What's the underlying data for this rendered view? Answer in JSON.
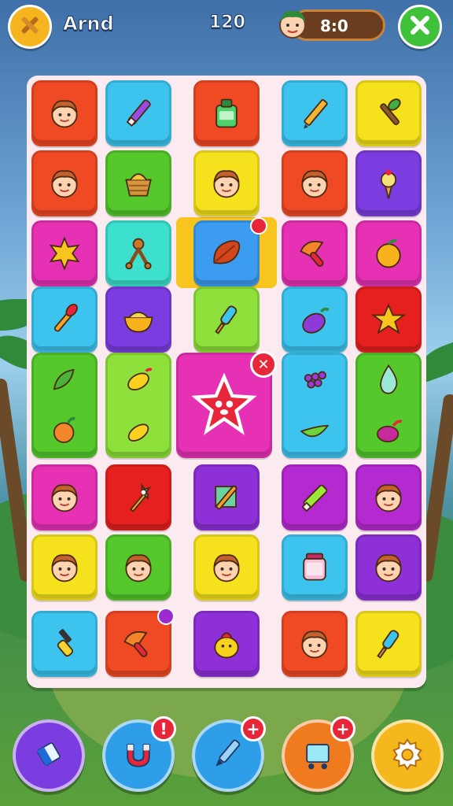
{
  "header": {
    "menu_icon": "crossed-tools-icon",
    "title": "Arnd",
    "score": "120",
    "coins": "8:0",
    "close_icon": "close-icon"
  },
  "board": {
    "rows": 8,
    "cols": 5,
    "tiles": [
      {
        "color": "#f04a24",
        "icon": "face-icon"
      },
      {
        "color": "#3cc4ee",
        "icon": "marker-icon"
      },
      {
        "color": "#f04a24",
        "icon": "glue-bottle-icon"
      },
      {
        "color": "#3cc4ee",
        "icon": "pencil-icon"
      },
      {
        "color": "#f6e21c",
        "icon": "paint-brush-icon"
      },
      {
        "color": "#f04a24",
        "icon": "face-icon"
      },
      {
        "color": "#55c82c",
        "icon": "basket-icon"
      },
      {
        "color": "#f6e21c",
        "icon": "face-icon"
      },
      {
        "color": "#f04a24",
        "icon": "face-icon"
      },
      {
        "color": "#7b3de0",
        "icon": "ice-cream-icon"
      },
      {
        "color": "#e631b5",
        "icon": "sun-star-icon"
      },
      {
        "color": "#3ce0cc",
        "icon": "gingerbread-icon"
      },
      {
        "color": "#3c9cf0",
        "icon": "leaf-icon"
      },
      {
        "color": "#e631b5",
        "icon": "mushroom-icon"
      },
      {
        "color": "#e631b5",
        "icon": "orange-icon"
      },
      {
        "color": "#3cc4ee",
        "icon": "brush-icon"
      },
      {
        "color": "#7b3de0",
        "icon": "bowl-icon"
      },
      {
        "color": "#8ee03a",
        "icon": "popsicle-icon"
      },
      {
        "color": "#3cc4ee",
        "icon": "eggplant-icon"
      },
      {
        "color": "#e6201e",
        "icon": "star-icon"
      },
      {
        "color": "#55c82c",
        "icon": "pepper-icon"
      },
      {
        "color": "#8ee03a",
        "icon": "lemon-icon"
      },
      {
        "color": "#e631b5",
        "icon": "starfish-icon"
      },
      {
        "color": "#3cc4ee",
        "icon": "grapes-icon"
      },
      {
        "color": "#55c82c",
        "icon": "drop-icon"
      },
      {
        "color": "#e631b5",
        "icon": "face-icon"
      },
      {
        "color": "#e6201e",
        "icon": "pinwheel-icon"
      },
      {
        "color": "#8e30d8",
        "icon": "frame-brush-icon"
      },
      {
        "color": "#b52ad0",
        "icon": "glue-tube-icon"
      },
      {
        "color": "#b52ad0",
        "icon": "face-icon"
      },
      {
        "color": "#f6e21c",
        "icon": "face-icon"
      },
      {
        "color": "#55c82c",
        "icon": "face-icon"
      },
      {
        "color": "#f6e21c",
        "icon": "face-icon"
      },
      {
        "color": "#3cc4ee",
        "icon": "jar-icon"
      },
      {
        "color": "#8e30d8",
        "icon": "face-icon"
      },
      {
        "color": "#3cc4ee",
        "icon": "screwdriver-icon"
      },
      {
        "color": "#f04a24",
        "icon": "mushroom-icon"
      },
      {
        "color": "#8e30d8",
        "icon": "chick-icon"
      },
      {
        "color": "#f04a24",
        "icon": "face-icon"
      },
      {
        "color": "#f6e21c",
        "icon": "popsicle-icon"
      }
    ]
  },
  "powerups": [
    {
      "icon": "eraser-icon",
      "color": "#7b3de0"
    },
    {
      "icon": "magnet-icon",
      "color": "#2f9ee8"
    },
    {
      "icon": "pen-icon",
      "color": "#2f9ee8"
    },
    {
      "icon": "cart-icon",
      "color": "#f07a1e"
    },
    {
      "icon": "settings-icon",
      "color": "#f5b81c"
    }
  ]
}
